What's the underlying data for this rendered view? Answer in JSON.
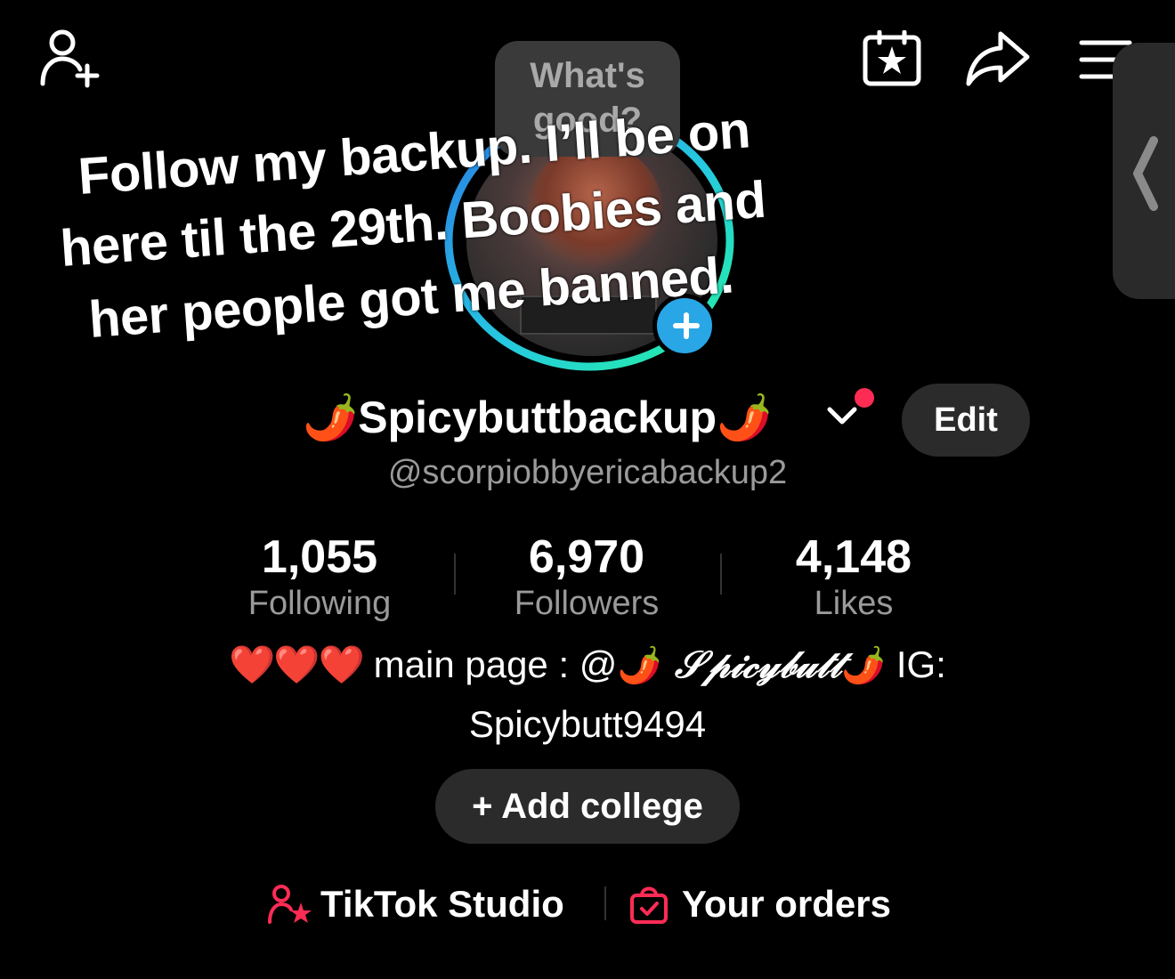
{
  "header": {
    "icons": [
      "add-friend-icon",
      "calendar-star-icon",
      "share-icon",
      "menu-icon"
    ],
    "side_panel_icon": "chevron-left-icon"
  },
  "note": {
    "line1": "What's",
    "line2": "good?"
  },
  "caption": {
    "line1": "Follow my backup. I’ll be on",
    "line2": "here til the 29th. Boobies and",
    "line3": "her people got me banned."
  },
  "profile": {
    "display_name": "🌶️Spicybuttbackup🌶️",
    "username": "@scorpiobbyericabackup2",
    "edit_label": "Edit"
  },
  "stats": {
    "following_count": "1,055",
    "following_label": "Following",
    "followers_count": "6,970",
    "followers_label": "Followers",
    "likes_count": "4,148",
    "likes_label": "Likes"
  },
  "bio": {
    "hearts": "❤️❤️❤️",
    "main_prefix": " main page : @",
    "pepper1": "🌶️",
    "fancy_name": " 𝒮𝓅𝒾𝒸𝓎𝒷𝓊𝓉𝓉",
    "pepper2": "🌶️",
    "ig_label": " IG:",
    "line2": "Spicybutt9494"
  },
  "actions": {
    "add_college": "+ Add college",
    "studio_label": "TikTok Studio",
    "orders_label": "Your orders"
  },
  "colors": {
    "background": "#000000",
    "accent_red": "#fe2c55",
    "badge_blue": "#29a6e6",
    "ring_cyan": "#25f4ee"
  }
}
